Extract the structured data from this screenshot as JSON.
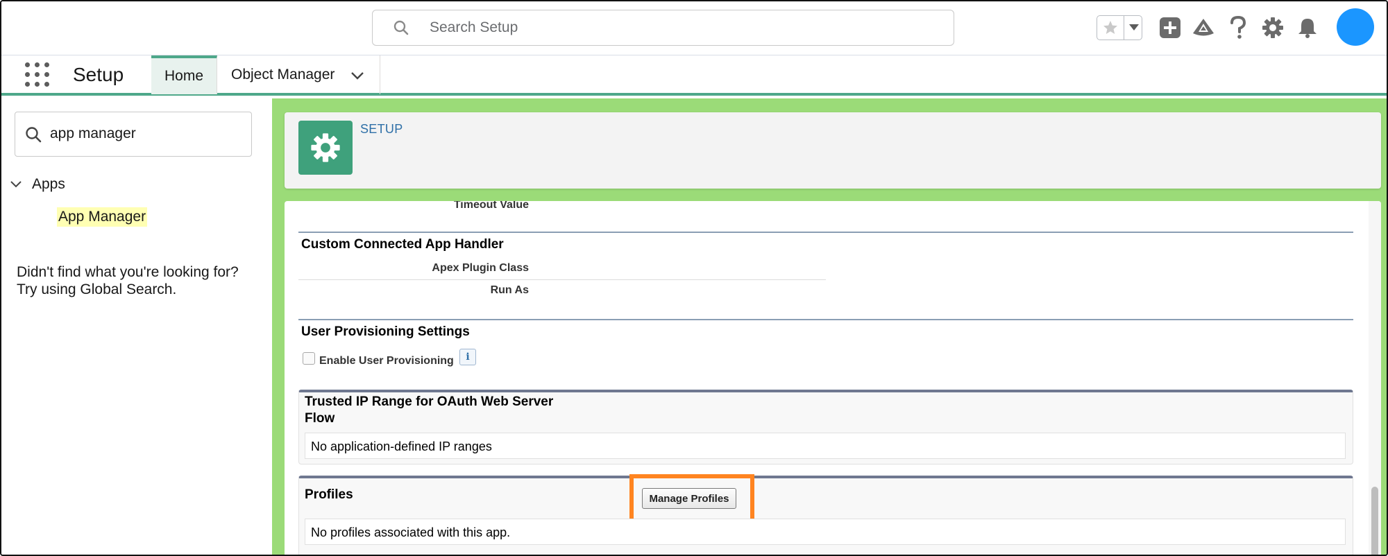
{
  "global_header": {
    "search_placeholder": "Search Setup",
    "icons": [
      "favorites-star-icon",
      "favorites-dropdown-icon",
      "global-actions-plus-icon",
      "trailhead-icon",
      "help-icon",
      "setup-gear-icon",
      "notifications-bell-icon"
    ],
    "avatar_color": "#1b96ff"
  },
  "context_nav": {
    "app_name": "Setup",
    "tabs": [
      {
        "label": "Home",
        "active": true
      },
      {
        "label": "Object Manager",
        "active": false
      }
    ]
  },
  "sidebar": {
    "quick_find_value": "app manager",
    "tree": {
      "group_label": "Apps",
      "item_label": "App Manager"
    },
    "not_found_line1": "Didn't find what you're looking for?",
    "not_found_line2": "Try using Global Search."
  },
  "setup_header": {
    "label": "SETUP"
  },
  "detail": {
    "timeout_label": "Timeout Value",
    "custom_handler": {
      "title": "Custom Connected App Handler",
      "apex_plugin_label": "Apex Plugin Class",
      "run_as_label": "Run As"
    },
    "user_provisioning": {
      "title": "User Provisioning Settings",
      "checkbox_label": "Enable User Provisioning",
      "checkbox_checked": false,
      "info_icon": "i"
    },
    "trusted_ip": {
      "title_line1": "Trusted IP Range for OAuth Web Server",
      "title_line2": "Flow",
      "empty_text": "No application-defined IP ranges"
    },
    "profiles": {
      "title": "Profiles",
      "button_label": "Manage Profiles",
      "empty_text": "No profiles associated with this app."
    }
  },
  "colors": {
    "brand_green": "#4ea88a",
    "background_green": "#9bdb78",
    "highlight_orange": "#ff8420",
    "link_blue": "#2e6fa7"
  }
}
